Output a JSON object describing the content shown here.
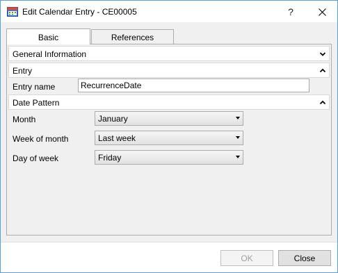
{
  "window": {
    "title": "Edit Calendar Entry - CE00005",
    "help_label": "?"
  },
  "tabs": [
    {
      "label": "Basic",
      "selected": true
    },
    {
      "label": "References",
      "selected": false
    }
  ],
  "sections": {
    "general": {
      "label": "General Information",
      "expanded": false
    },
    "entry": {
      "label": "Entry",
      "expanded": true
    },
    "date_pattern": {
      "label": "Date Pattern",
      "expanded": true
    }
  },
  "entry": {
    "name_label": "Entry name",
    "name_value": "RecurrenceDate"
  },
  "date_pattern": {
    "month_label": "Month",
    "month_value": "January",
    "week_label": "Week of month",
    "week_value": "Last week",
    "day_label": "Day of week",
    "day_value": "Friday"
  },
  "buttons": {
    "ok_label": "OK",
    "ok_enabled": false,
    "close_label": "Close"
  },
  "icons": {
    "app": "calendar-app-icon",
    "close": "close-icon",
    "expand": "chevron-down-icon",
    "collapse": "chevron-up-icon",
    "dropdown": "dropdown-arrow-icon"
  },
  "colors": {
    "window_border": "#5c9fd6",
    "dialog_background": "#f0f0f0",
    "disabled_text": "#a0a0a0"
  }
}
